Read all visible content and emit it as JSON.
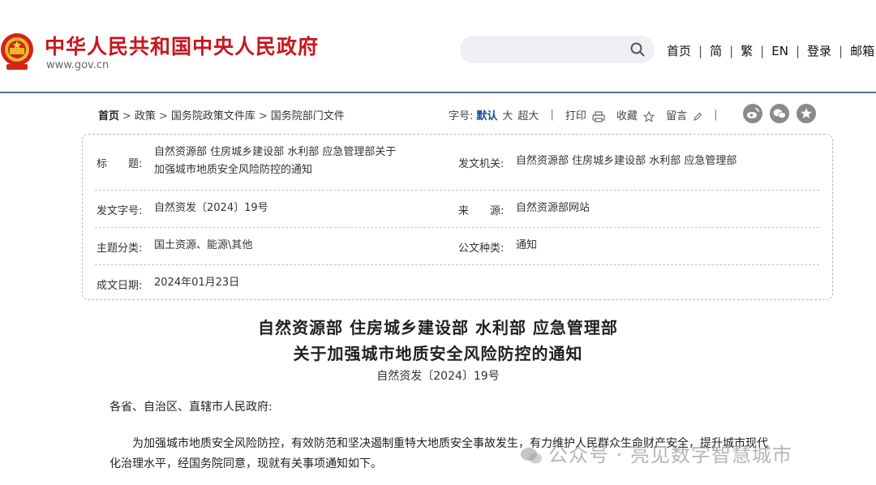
{
  "header": {
    "site_title": "中华人民共和国中央人民政府",
    "site_url": "www.gov.cn",
    "search_placeholder": "",
    "nav": [
      "首页",
      "简",
      "繁",
      "EN",
      "登录",
      "邮箱"
    ]
  },
  "breadcrumb": {
    "items": [
      "首页",
      "政策",
      "国务院政策文件库",
      "国务院部门文件"
    ]
  },
  "tools": {
    "font_label": "字号:",
    "font_default": "默认",
    "font_large": "大",
    "font_xlarge": "超大",
    "print": "打印",
    "favorite": "收藏",
    "comment": "留言"
  },
  "info": {
    "title_label": "标　　题:",
    "title_value": "自然资源部 住房城乡建设部 水利部 应急管理部关于加强城市地质安全风险防控的通知",
    "issuer_label": "发文机关:",
    "issuer_value": "自然资源部 住房城乡建设部 水利部 应急管理部",
    "docno_label": "发文字号:",
    "docno_value": "自然资发〔2024〕19号",
    "source_label": "来　　源:",
    "source_value": "自然资源部网站",
    "topic_label": "主题分类:",
    "topic_value": "国土资源、能源\\其他",
    "type_label": "公文种类:",
    "type_value": "通知",
    "date_label": "成文日期:",
    "date_value": "2024年01月23日"
  },
  "article": {
    "title_line1": "自然资源部 住房城乡建设部 水利部 应急管理部",
    "title_line2": "关于加强城市地质安全风险防控的通知",
    "doc_number": "自然资发〔2024〕19号",
    "salutation": "各省、自治区、直辖市人民政府:",
    "para1_line1": "为加强城市地质安全风险防控，有效防范和坚决遏制重特大地质安全事故发生，有力维护人民群众生命财产安全，提升城市现代",
    "para1_line2": "化治理水平，经国务院同意，现就有关事项通知如下。"
  },
  "watermark": "公众号 · 亮见数字智慧城市",
  "colors": {
    "brand_red": "#c8161d",
    "rule_blue": "#4a6fa5",
    "active_blue": "#1a4d9c"
  }
}
